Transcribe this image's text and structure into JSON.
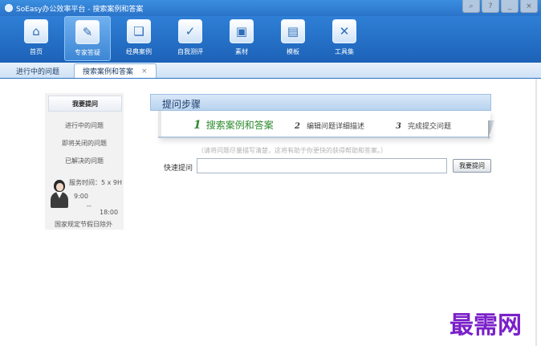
{
  "window": {
    "title": "SoEasy办公效率平台 - 搜索案例和答案"
  },
  "toolbar": {
    "items": [
      {
        "label": "首页",
        "icon": "home-icon",
        "glyph": "⌂"
      },
      {
        "label": "专家答疑",
        "icon": "expert-qa-icon",
        "glyph": "✎"
      },
      {
        "label": "经典案例",
        "icon": "case-book-icon",
        "glyph": "❏"
      },
      {
        "label": "自我测评",
        "icon": "self-test-icon",
        "glyph": "✓"
      },
      {
        "label": "素材",
        "icon": "material-icon",
        "glyph": "▣"
      },
      {
        "label": "模板",
        "icon": "template-icon",
        "glyph": "▤"
      },
      {
        "label": "工具集",
        "icon": "tools-icon",
        "glyph": "✕"
      }
    ],
    "active_index": 1
  },
  "tabs": [
    {
      "label": "进行中的问题"
    },
    {
      "label": "搜索案例和答案",
      "close": "×"
    }
  ],
  "sidebar": {
    "items": [
      {
        "label": "我要提问"
      },
      {
        "label": "进行中的问题"
      },
      {
        "label": "即将关闭的问题"
      },
      {
        "label": "已解决的问题"
      }
    ],
    "service": {
      "label": "服务时间：5 x 9H",
      "start": "9:00",
      "dash": "--",
      "end": "18:00",
      "note": "国家规定节假日除外"
    }
  },
  "steps": {
    "header": "提问步骤",
    "items": [
      {
        "num": "1",
        "label": "搜索案例和答案"
      },
      {
        "num": "2",
        "label": "编辑问题详细描述"
      },
      {
        "num": "3",
        "label": "完成提交问题"
      }
    ]
  },
  "form": {
    "hint": "（请将问题尽量描写清楚，这将有助于你更快的获得帮助和答案。）",
    "quick_label": "快速提问",
    "input_value": "",
    "submit_label": "我要提问"
  },
  "watermark": "最需网",
  "colors": {
    "accent_blue": "#2a73c9",
    "step_green": "#2d8a2d",
    "watermark_purple": "#7b1fc9"
  }
}
